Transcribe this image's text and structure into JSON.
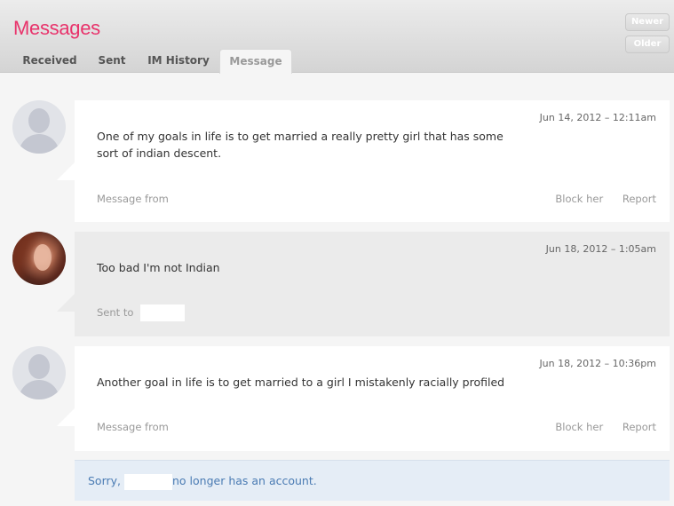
{
  "header": {
    "title": "Messages",
    "tabs": [
      "Received",
      "Sent",
      "IM History",
      "Message"
    ],
    "newer": "Newer",
    "older": "Older"
  },
  "messages": [
    {
      "date": "Jun 14, 2012 – 12:11am",
      "text": "One of my goals in life is to get married a really pretty girl that has some sort of indian descent.",
      "meta": "Message from",
      "block": "Block her",
      "report": "Report",
      "avatar": "default-avatar-icon"
    },
    {
      "date": "Jun 18, 2012 – 1:05am",
      "text": "Too bad I'm not Indian",
      "meta": "Sent to",
      "avatar": "user-photo"
    },
    {
      "date": "Jun 18, 2012 – 10:36pm",
      "text": "Another goal in life is to get married to a girl I mistakenly racially profiled",
      "meta": "Message from",
      "block": "Block her",
      "report": "Report",
      "avatar": "default-avatar-icon"
    }
  ],
  "notice": {
    "prefix": "Sorry,",
    "suffix": "no longer has an account."
  },
  "colors": {
    "title": "#e8336b",
    "notice_text": "#4a7bb3",
    "notice_bg": "#e5edf6"
  }
}
